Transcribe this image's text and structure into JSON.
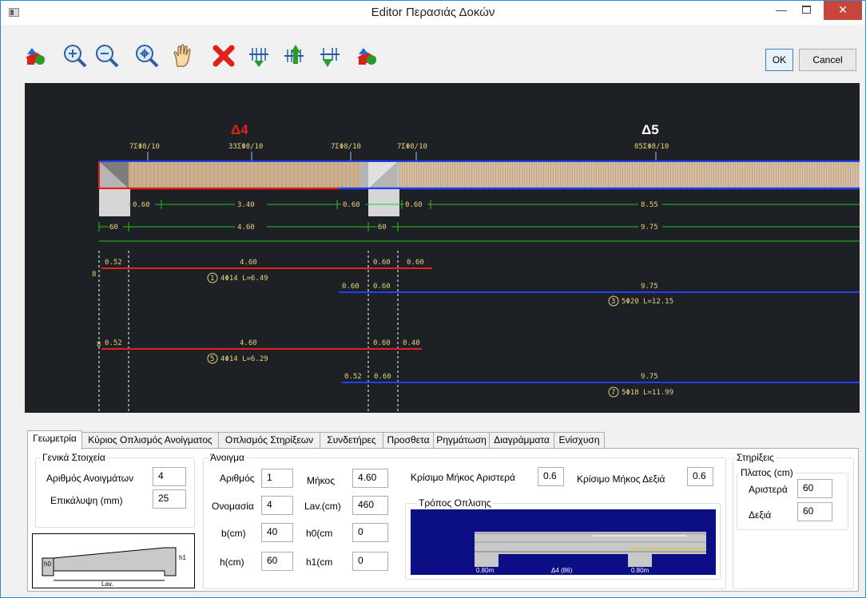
{
  "window": {
    "title": "Editor Περασιάς Δοκών",
    "close_glyph": "✕",
    "minimize_glyph": "—"
  },
  "toolbar": {
    "icons": [
      "view-3d-icon",
      "zoom-in-icon",
      "zoom-out-icon",
      "zoom-window-icon",
      "pan-hand-icon",
      "delete-icon",
      "rebar-distribute-icon",
      "rebar-up-icon",
      "rebar-down-icon",
      "view-3d-icon"
    ],
    "ok_label": "OK",
    "cancel_label": "Cancel"
  },
  "drawing": {
    "span_names": [
      "Δ4",
      "Δ5"
    ],
    "stirrup_labels": [
      "7ΣΦ8/10",
      "33ΣΦ8/10",
      "7ΣΦ8/10",
      "7ΣΦ8/10",
      "85ΣΦ8/10"
    ],
    "dim_row1": [
      "0.60",
      "3.40",
      "0.60",
      "0.60",
      "8.55"
    ],
    "dim_row2": [
      "60",
      "4.60",
      "60",
      "9.75"
    ],
    "bar1": {
      "left": "0.52",
      "mid": "4.60",
      "right_a": "0.60",
      "right_b": "0.60",
      "tag": "1",
      "desc": "4Φ14 L=6.49",
      "hook": "8"
    },
    "bar3": {
      "left_a": "0.60",
      "left_b": "0.60",
      "mid": "9.75",
      "tag": "3",
      "desc": "5Φ20 L=12.15"
    },
    "bar5": {
      "left": "0.52",
      "mid": "4.60",
      "right_a": "0.60",
      "right_b": "0.40",
      "tag": "5",
      "desc": "4Φ14 L=6.29",
      "hook": "8"
    },
    "bar7": {
      "left_a": "0.52",
      "left_b": "0.60",
      "mid": "9.75",
      "tag": "7",
      "desc": "5Φ18 L=11.99"
    }
  },
  "tabs": [
    "Γεωμετρία",
    "Κύριος Οπλισμός Ανοίγματος",
    "Οπλισμός Στηρίξεων",
    "Συνδετήρες",
    "Προσθετα",
    "Ρηγμάτωση",
    "Διαγράμματα",
    "Ενίσχυση"
  ],
  "general": {
    "group_label": "Γενικά Στοιχεία",
    "spans_label": "Αριθμός Ανοιγμάτων",
    "spans_value": "4",
    "cover_label": "Επικάλυψη (mm)",
    "cover_value": "25"
  },
  "span": {
    "group_label": "Άνοιγμα",
    "number_label": "Αριθμός",
    "number_value": "1",
    "length_label": "Μήκος",
    "length_value": "4.60",
    "name_label": "Ονομασία",
    "name_value": "4",
    "lav_label": "Lav.(cm)",
    "lav_value": "460",
    "b_label": "b(cm)",
    "b_value": "40",
    "h0_label": "h0(cm",
    "h0_value": "0",
    "h_label": "h(cm)",
    "h_value": "60",
    "h1_label": "h1(cm",
    "h1_value": "0",
    "crit_left_label": "Κρίσιμο Μήκος Αριστερά",
    "crit_left_value": "0.6",
    "crit_right_label": "Κρίσιμο Μήκος Δεξιά",
    "crit_right_value": "0.6"
  },
  "reinforcement_mode": {
    "group_label": "Τρόπος Οπλισης",
    "left_support": "0.80m",
    "span_label": "Δ4 (86)",
    "right_support": "0.80m"
  },
  "supports": {
    "group_label": "Στηρίξεις",
    "width_group_label": "Πλατος (cm)",
    "left_label": "Αριστερά",
    "left_value": "60",
    "right_label": "Δεξιά",
    "right_value": "60"
  },
  "section_diagram": {
    "h0": "h0",
    "h1": "h1",
    "lav": "Lav."
  }
}
